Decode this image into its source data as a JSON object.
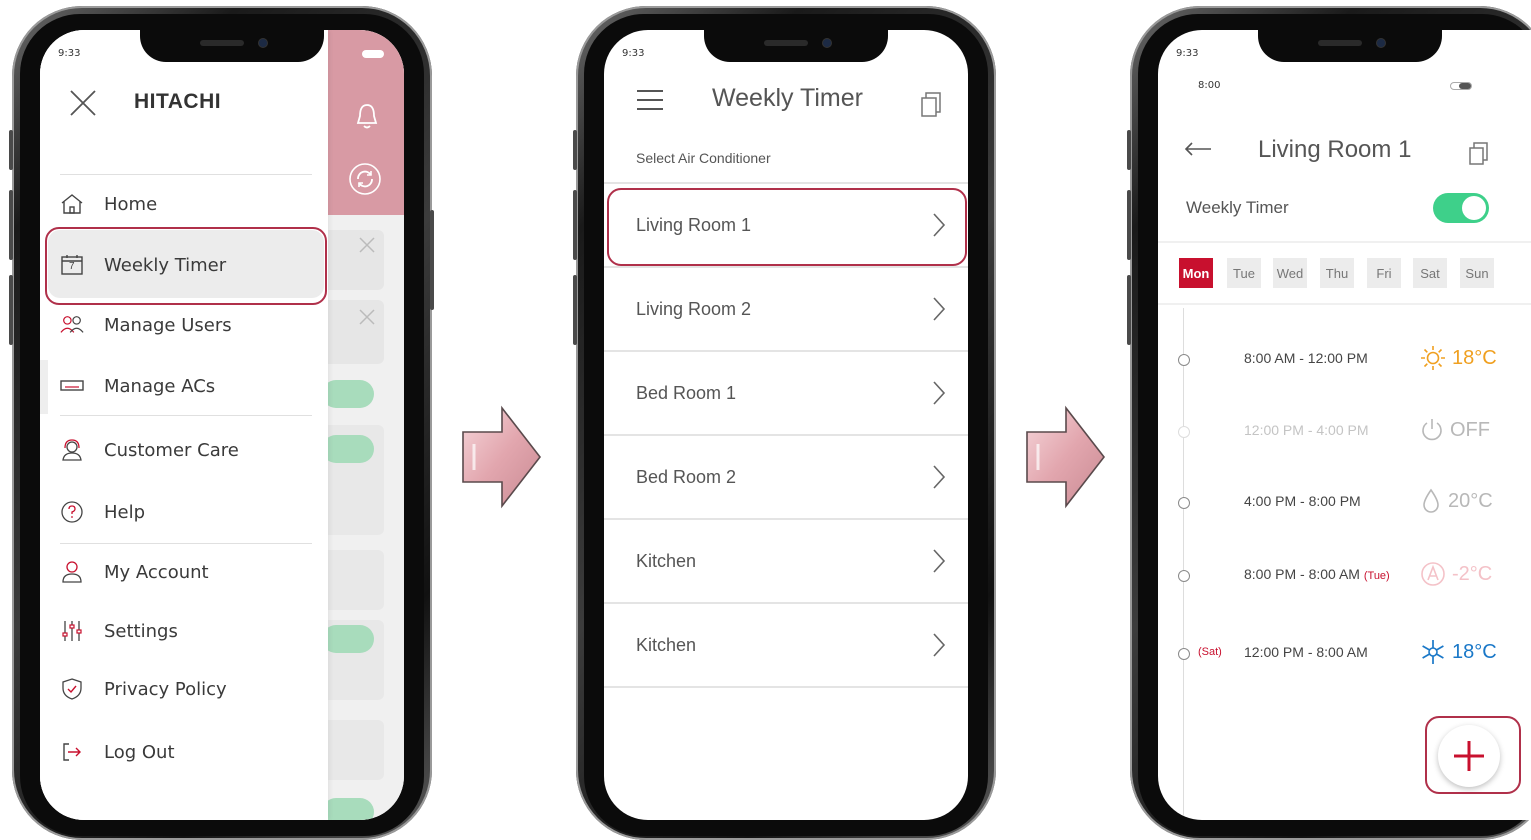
{
  "colors": {
    "brand": "#c8102e",
    "highlight": "#b0304a",
    "toggle": "#3ed08a",
    "arrow": "#e8b4ba"
  },
  "screen1": {
    "time": "9:33",
    "brand": "HITACHI",
    "menu": [
      {
        "label": "Home",
        "icon": "home-icon"
      },
      {
        "label": "Weekly Timer",
        "icon": "calendar-icon",
        "calendar_day": "7"
      },
      {
        "label": "Manage Users",
        "icon": "users-icon"
      },
      {
        "label": "Manage ACs",
        "icon": "ac-unit-icon"
      },
      {
        "label": "Customer Care",
        "icon": "headset-icon"
      },
      {
        "label": "Help",
        "icon": "help-icon"
      },
      {
        "label": "My Account",
        "icon": "person-icon"
      },
      {
        "label": "Settings",
        "icon": "sliders-icon"
      },
      {
        "label": "Privacy Policy",
        "icon": "shield-icon"
      },
      {
        "label": "Log Out",
        "icon": "logout-icon"
      }
    ]
  },
  "screen2": {
    "time": "9:33",
    "title": "Weekly Timer",
    "subtitle": "Select Air Conditioner",
    "rooms": [
      "Living Room 1",
      "Living Room 2",
      "Bed Room 1",
      "Bed Room 2",
      "Kitchen",
      "Kitchen"
    ]
  },
  "screen3": {
    "time": "9:33",
    "time2": "8:00",
    "title": "Living Room 1",
    "weekly_timer_label": "Weekly Timer",
    "weekly_timer_on": true,
    "days": [
      "Mon",
      "Tue",
      "Wed",
      "Thu",
      "Fri",
      "Sat",
      "Sun"
    ],
    "active_day": "Mon",
    "schedules": [
      {
        "range": "8:00 AM - 12:00 PM",
        "mode": "heat-icon",
        "value": "18°C",
        "color": "#f0a020",
        "faded": false,
        "prefix": "",
        "suffix": ""
      },
      {
        "range": "12:00 PM - 4:00 PM",
        "mode": "power-icon",
        "value": "OFF",
        "color": "#b8b8b8",
        "faded": true,
        "prefix": "",
        "suffix": ""
      },
      {
        "range": "4:00 PM - 8:00 PM",
        "mode": "dry-icon",
        "value": "20°C",
        "color": "#b8b8b8",
        "faded": false,
        "prefix": "",
        "suffix": ""
      },
      {
        "range": "8:00 PM - 8:00 AM",
        "mode": "auto-icon",
        "value": "-2°C",
        "color": "#f4c2c8",
        "faded": false,
        "prefix": "",
        "suffix": "(Tue)"
      },
      {
        "range": "12:00 PM - 8:00 AM",
        "mode": "cool-icon",
        "value": "18°C",
        "color": "#1a78c8",
        "faded": false,
        "prefix": "(Sat)",
        "suffix": ""
      }
    ]
  }
}
